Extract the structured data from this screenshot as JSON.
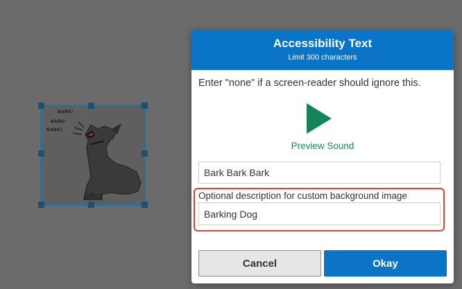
{
  "canvas": {
    "image_alt": "barking dog",
    "bark_texts": [
      "BARK!",
      "BARK!",
      "BARK!"
    ]
  },
  "dialog": {
    "title": "Accessibility Text",
    "subtitle": "Limit 300 characters",
    "hint": "Enter \"none\" if a screen-reader should ignore this.",
    "preview_label": "Preview Sound",
    "title_value": "Bark Bark Bark",
    "description_label": "Optional description for custom background image",
    "description_value": "Barking Dog",
    "cancel_label": "Cancel",
    "okay_label": "Okay"
  },
  "colors": {
    "header": "#0a74c7",
    "play": "#12855a",
    "highlight": "#d9433b",
    "selection": "#2f6d94"
  },
  "icons": {
    "play": "play-icon"
  }
}
